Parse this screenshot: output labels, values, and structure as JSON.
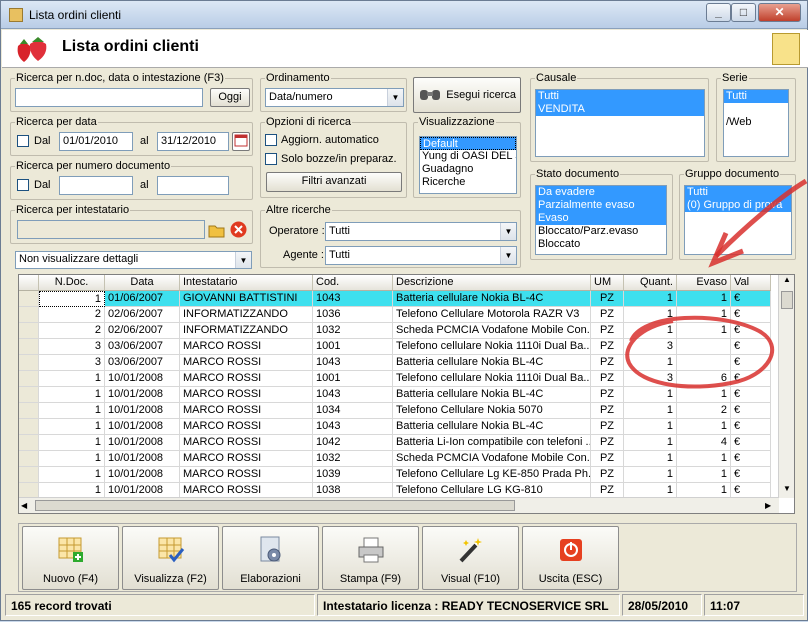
{
  "window": {
    "title": "Lista ordini clienti",
    "min": "_",
    "max": "□",
    "close": "✕"
  },
  "header": {
    "title": "Lista ordini clienti"
  },
  "search_ndoc": {
    "legend": "Ricerca per n.doc, data o intestazione (F3)",
    "value": "",
    "button": "Oggi"
  },
  "search_date": {
    "legend": "Ricerca per data",
    "dal_label": "Dal",
    "dal_value": "01/01/2010",
    "al_label": "al",
    "al_value": "31/12/2010"
  },
  "search_num": {
    "legend": "Ricerca per numero documento",
    "dal_label": "Dal",
    "dal_value": "",
    "al_label": "al",
    "al_value": ""
  },
  "search_int": {
    "legend": "Ricerca per intestatario",
    "value": ""
  },
  "details_select": "Non visualizzare dettagli",
  "ordinamento": {
    "legend": "Ordinamento",
    "value": "Data/numero"
  },
  "esegui": "Esegui ricerca",
  "opzioni": {
    "legend": "Opzioni di ricerca",
    "aggiorn": "Aggiorn. automatico",
    "solo_bozze": "Solo bozze/in preparaz.",
    "filtri": "Filtri avanzati"
  },
  "visualizzazione": {
    "legend": "Visualizzazione",
    "items": [
      "Default",
      "Yung di OASI DEL S",
      "Guadagno",
      "Ricerche"
    ],
    "selected": 0
  },
  "altre": {
    "legend": "Altre ricerche",
    "operatore_label": "Operatore :",
    "operatore_value": "Tutti",
    "agente_label": "Agente :",
    "agente_value": "Tutti"
  },
  "causale": {
    "legend": "Causale",
    "items": [
      "Tutti",
      "VENDITA"
    ]
  },
  "serie": {
    "legend": "Serie",
    "items": [
      "Tutti",
      "",
      "/Web"
    ]
  },
  "stato": {
    "legend": "Stato documento",
    "items": [
      "Da evadere",
      "Parzialmente evaso",
      "Evaso",
      "Bloccato/Parz.evaso",
      "Bloccato"
    ],
    "selected_count": 3
  },
  "gruppo": {
    "legend": "Gruppo documento",
    "items": [
      "Tutti",
      "(0) Gruppo di prova"
    ]
  },
  "grid": {
    "headers": [
      "N.Doc.",
      "Data",
      "Intestatario",
      "Cod.",
      "Descrizione",
      "UM",
      "Quant.",
      "Evaso",
      "Val"
    ],
    "rows": [
      [
        "1",
        "01/06/2007",
        "GIOVANNI BATTISTINI",
        "1043",
        "Batteria cellulare Nokia BL-4C",
        "PZ",
        "1",
        "1",
        "€"
      ],
      [
        "2",
        "02/06/2007",
        "INFORMATIZZANDO",
        "1036",
        "Telefono Cellulare Motorola RAZR V3",
        "PZ",
        "1",
        "1",
        "€"
      ],
      [
        "2",
        "02/06/2007",
        "INFORMATIZZANDO",
        "1032",
        "Scheda PCMCIA Vodafone Mobile Con...",
        "PZ",
        "1",
        "1",
        "€"
      ],
      [
        "3",
        "03/06/2007",
        "MARCO ROSSI",
        "1001",
        "Telefono cellulare Nokia 1110i Dual Ba...",
        "PZ",
        "3",
        "",
        "€"
      ],
      [
        "3",
        "03/06/2007",
        "MARCO ROSSI",
        "1043",
        "Batteria cellulare Nokia BL-4C",
        "PZ",
        "1",
        "",
        "€"
      ],
      [
        "1",
        "10/01/2008",
        "MARCO ROSSI",
        "1001",
        "Telefono cellulare Nokia 1110i Dual Ba...",
        "PZ",
        "3",
        "6",
        "€"
      ],
      [
        "1",
        "10/01/2008",
        "MARCO ROSSI",
        "1043",
        "Batteria cellulare Nokia BL-4C",
        "PZ",
        "1",
        "1",
        "€"
      ],
      [
        "1",
        "10/01/2008",
        "MARCO ROSSI",
        "1034",
        "Telefono Cellulare Nokia 5070",
        "PZ",
        "1",
        "2",
        "€"
      ],
      [
        "1",
        "10/01/2008",
        "MARCO ROSSI",
        "1043",
        "Batteria cellulare Nokia BL-4C",
        "PZ",
        "1",
        "1",
        "€"
      ],
      [
        "1",
        "10/01/2008",
        "MARCO ROSSI",
        "1042",
        "Batteria Li-Ion compatibile con telefoni ...",
        "PZ",
        "1",
        "4",
        "€"
      ],
      [
        "1",
        "10/01/2008",
        "MARCO ROSSI",
        "1032",
        "Scheda PCMCIA Vodafone Mobile Con...",
        "PZ",
        "1",
        "1",
        "€"
      ],
      [
        "1",
        "10/01/2008",
        "MARCO ROSSI",
        "1039",
        "Telefono Cellulare Lg KE-850 Prada Ph...",
        "PZ",
        "1",
        "1",
        "€"
      ],
      [
        "1",
        "10/01/2008",
        "MARCO ROSSI",
        "1038",
        "Telefono Cellulare LG KG-810",
        "PZ",
        "1",
        "1",
        "€"
      ]
    ]
  },
  "toolbar": {
    "nuovo": "Nuovo (F4)",
    "visualizza": "Visualizza (F2)",
    "elaborazioni": "Elaborazioni",
    "stampa": "Stampa (F9)",
    "visual": "Visual (F10)",
    "uscita": "Uscita (ESC)"
  },
  "status": {
    "records": "165 record trovati",
    "licenza": "Intestatario licenza : READY TECNOSERVICE SRL",
    "date": "28/05/2010",
    "time": "11:07"
  }
}
